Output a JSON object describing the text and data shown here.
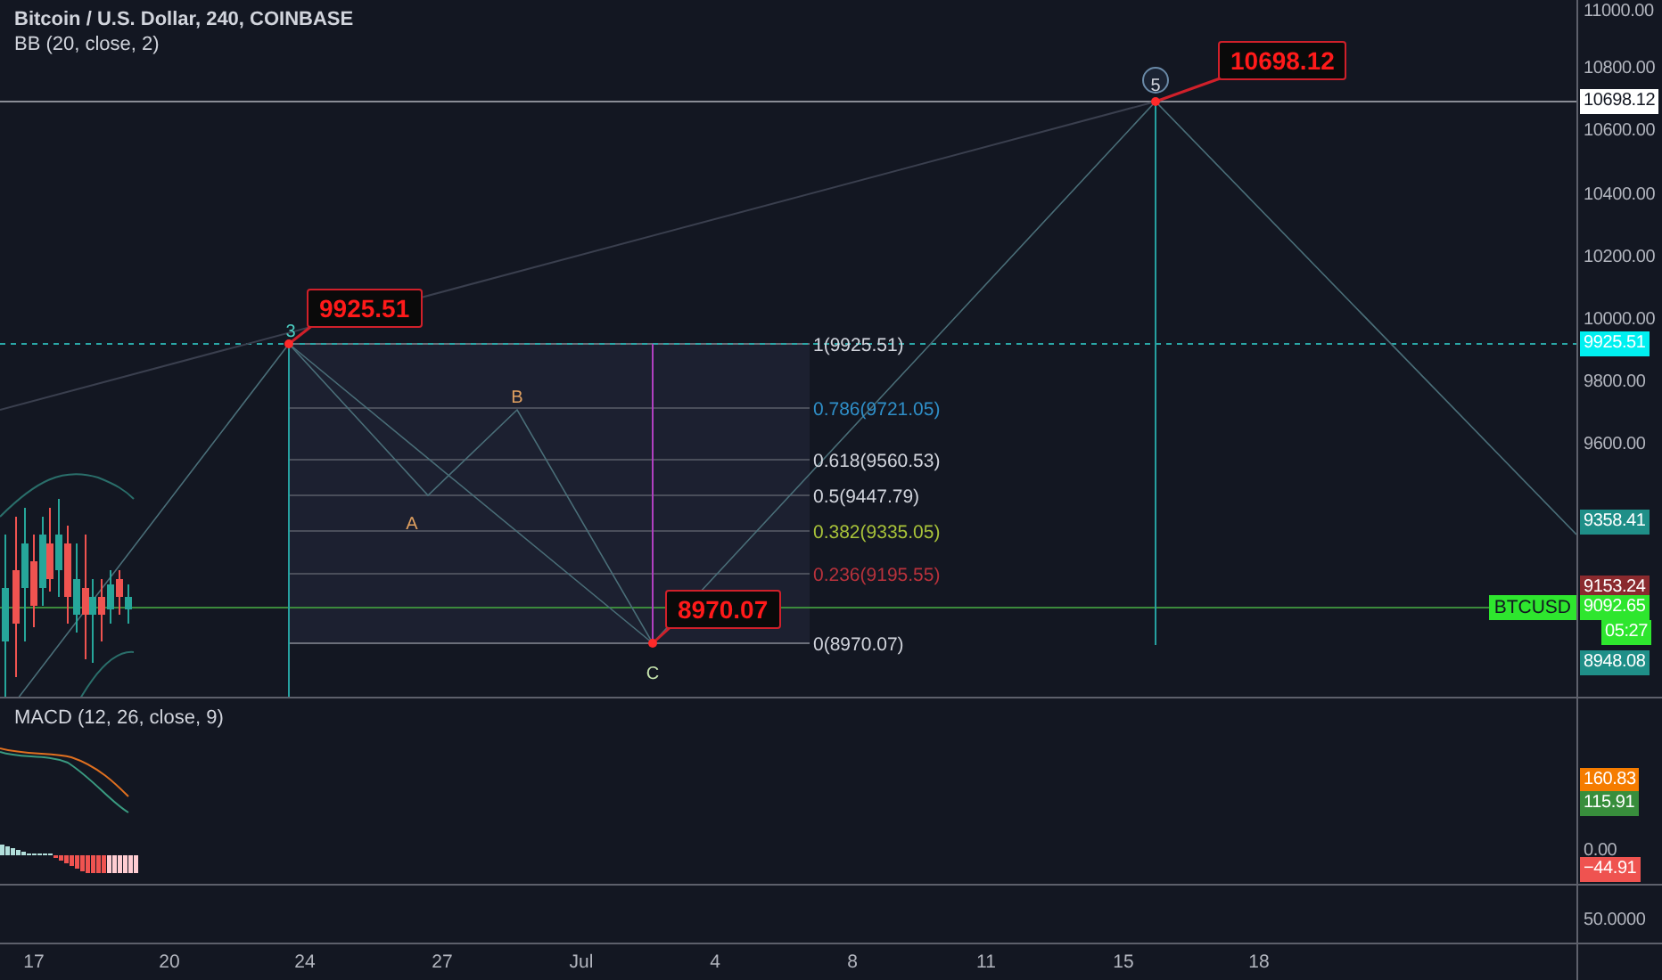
{
  "legend": {
    "symbol": "Bitcoin / U.S. Dollar, 240, COINBASE",
    "indicator": "BB (20, close, 2)"
  },
  "chart": {
    "wave_labels": [
      {
        "text": "3",
        "color": "#4dd0c4"
      },
      {
        "text": "A",
        "color": "#e0a060"
      },
      {
        "text": "B",
        "color": "#e0a060"
      },
      {
        "text": "C",
        "color": "#c8e6b0"
      },
      {
        "text": "5",
        "color": "#d1d4dc"
      }
    ],
    "callouts": [
      "9925.51",
      "8970.07",
      "10698.12"
    ],
    "fib_levels": [
      {
        "text": "1(9925.51)",
        "color": "#d1d4dc"
      },
      {
        "text": "0.786(9721.05)",
        "color": "#2f8fc8"
      },
      {
        "text": "0.618(9560.53)",
        "color": "#d1d4dc"
      },
      {
        "text": "0.5(9447.79)",
        "color": "#d1d4dc"
      },
      {
        "text": "0.382(9335.05)",
        "color": "#a8c23a"
      },
      {
        "text": "0.236(9195.55)",
        "color": "#b8323c"
      },
      {
        "text": "0(8970.07)",
        "color": "#d1d4dc"
      }
    ],
    "symbol_tag": "BTCUSD"
  },
  "price_axis": {
    "ticks": [
      "11000.00",
      "10800.00",
      "10600.00",
      "10400.00",
      "10200.00",
      "10000.00",
      "9800.00",
      "9600.00"
    ],
    "badges": [
      {
        "text": "10698.12",
        "color": "#ffffff"
      },
      {
        "text": "9925.51",
        "color": "#00f0f0"
      },
      {
        "text": "9358.41",
        "color": "#1f8f88"
      },
      {
        "text": "9153.24",
        "color": "#8a2a2e"
      },
      {
        "text": "9092.65",
        "color": "#2ee62e"
      },
      {
        "text": "05:27",
        "color": "#2ee62e"
      },
      {
        "text": "8948.08",
        "color": "#1f8f88"
      }
    ]
  },
  "macd": {
    "title": "MACD (12, 26, close, 9)",
    "ticks": [
      "0.00"
    ],
    "badges": [
      {
        "text": "160.83",
        "color": "#f57c00"
      },
      {
        "text": "115.91",
        "color": "#388e3c"
      },
      {
        "text": "−44.91",
        "color": "#ef5350"
      }
    ]
  },
  "lower_pane": {
    "ticks": [
      "50.0000"
    ]
  },
  "time_axis": [
    "17",
    "20",
    "24",
    "27",
    "Jul",
    "4",
    "8",
    "11",
    "15",
    "18"
  ]
}
